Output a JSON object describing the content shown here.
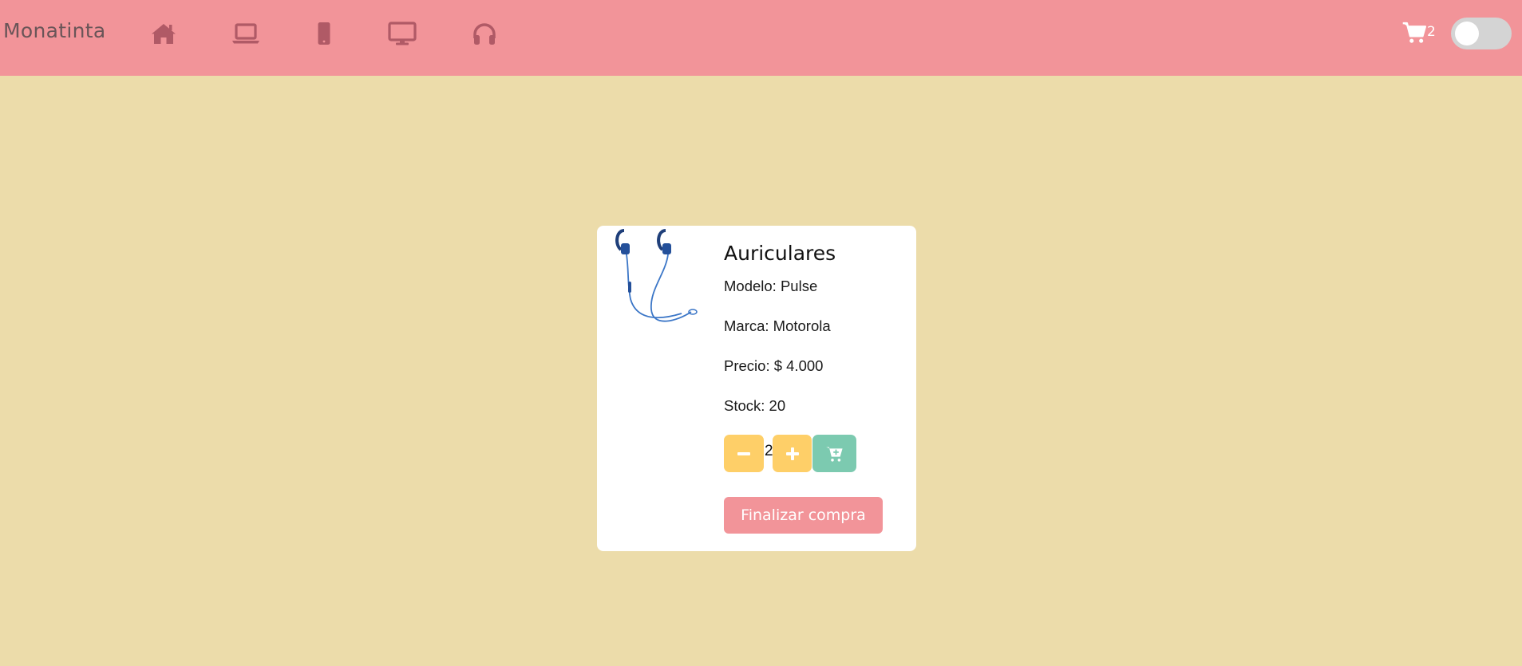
{
  "navbar": {
    "brand": "Monatinta",
    "icons": [
      "home-icon",
      "laptop-icon",
      "mobile-icon",
      "desktop-icon",
      "headphones-icon"
    ],
    "cart_icon": "cart-icon",
    "cart_count": "2",
    "dark_mode_toggle": "off"
  },
  "product": {
    "image": "earphones-image",
    "title": "Auriculares",
    "model": "Modelo: Pulse",
    "brand": "Marca: Motorola",
    "price": "Precio: $ 4.000",
    "stock": "Stock: 20",
    "quantity": "2",
    "minus_icon": "minus-icon",
    "plus_icon": "plus-icon",
    "add_to_cart_icon": "cart-plus-icon",
    "finish_label": "Finalizar compra"
  },
  "colors": {
    "navbar_bg": "#f29499",
    "page_bg": "#ecdcaa",
    "nav_icon": "#b05a66",
    "qty_button": "#fecf68",
    "add_button": "#7ccab0",
    "finish_button": "#f29499"
  }
}
